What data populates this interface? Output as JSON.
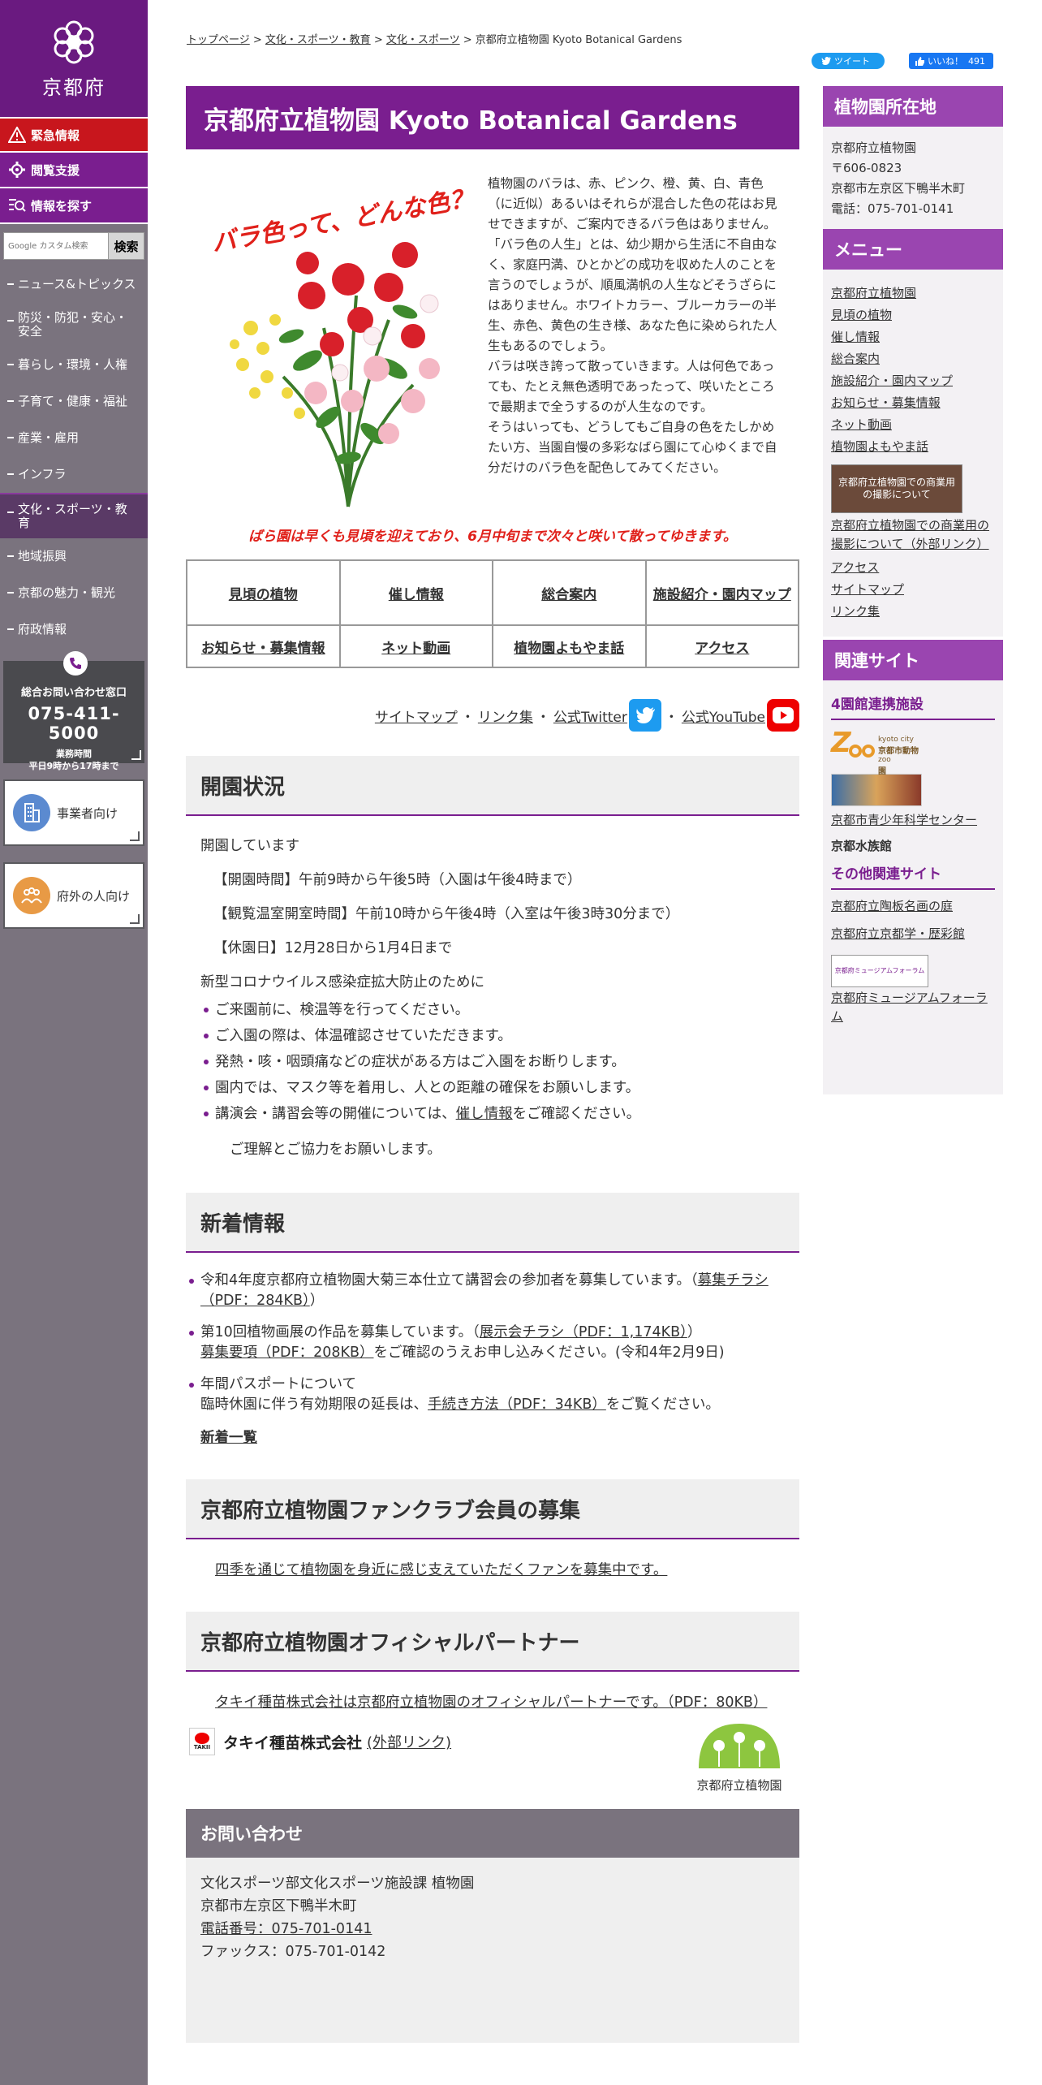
{
  "header": {
    "site_name": "京都府",
    "breadcrumb": [
      {
        "label": "トップページ"
      },
      {
        "label": "文化・スポーツ・教育"
      },
      {
        "label": "文化・スポーツ"
      }
    ],
    "breadcrumb_current": "京都府立植物園 Kyoto Botanical Gardens",
    "tweet_label": "ツイート",
    "like_label": "いいね！",
    "like_count": "491"
  },
  "sidebar": {
    "emergency_label": "緊急情報",
    "support_label": "閲覧支援",
    "find_label": "情報を探す",
    "search_placeholder": "Google カスタム検索",
    "search_button": "検索",
    "nav": [
      {
        "label": "ニュース&トピックス"
      },
      {
        "label": "防災・防犯・安心・安全"
      },
      {
        "label": "暮らし・環境・人権"
      },
      {
        "label": "子育て・健康・福祉"
      },
      {
        "label": "産業・雇用"
      },
      {
        "label": "インフラ"
      },
      {
        "label": "文化・スポーツ・教育"
      },
      {
        "label": "地域振興"
      },
      {
        "label": "京都の魅力・観光"
      },
      {
        "label": "府政情報"
      }
    ],
    "contact": {
      "title": "総合お問い合わせ窓口",
      "phone": "075-411-5000",
      "hours_label": "業務時間",
      "hours": "平日9時から17時まで"
    },
    "business_label": "事業者向け",
    "outside_label": "府外の人向け"
  },
  "main": {
    "title": "京都府立植物園 Kyoto Botanical Gardens",
    "rose_art_title": "バラ色って、どんな色？",
    "intro_paragraphs": [
      "植物園のバラは、赤、ピンク、橙、黄、白、青色（に近似）あるいはそれらが混合した色の花はお見せできますが、ご案内できるバラ色はありません。",
      "「バラ色の人生」とは、幼少期から生活に不自由なく、家庭円満、ひとかどの成功を収めた人のことを言うのでしょうが、順風満帆の人生などそうざらにはありません。ホワイトカラー、ブルーカラーの半生、赤色、黄色の生き様、あなた色に染められた人生もあるのでしょう。",
      "バラは咲き誇って散っていきます。人は何色であっても、たとえ無色透明であったって、咲いたところで最期まで全うするのが人生なのです。",
      "そうはいっても、どうしてもご自身の色をたしかめたい方、当園自慢の多彩なばら園にて心ゆくまで自分だけのバラ色を配色してみてください。"
    ],
    "rose_notice": "ばら園は早くも見頃を迎えており、6月中旬まで次々と咲いて散ってゆきます。",
    "nav_table": [
      [
        "見頃の植物",
        "催し情報",
        "総合案内",
        "施設紹介・園内マップ"
      ],
      [
        "お知らせ・募集情報",
        "ネット動画",
        "植物園よもやま話",
        "アクセス"
      ]
    ],
    "links_row": {
      "sitemap": "サイトマップ",
      "links": "リンク集",
      "twitter": "公式Twitter",
      "youtube": "公式YouTube",
      "sep": "・"
    },
    "status": {
      "heading": "開園状況",
      "open_text": "開園しています",
      "hours": "【開園時間】午前9時から午後5時（入園は午後4時まで）",
      "greenhouse": "【観覧温室開室時間】午前10時から午後4時（入室は午後3時30分まで）",
      "closed": "【休園日】12月28日から1月4日まで",
      "covid_title": "新型コロナウイルス感染症拡大防止のために",
      "covid_items": [
        "ご来園前に、検温等を行ってください。",
        "ご入園の際は、体温確認させていただきます。",
        "発熱・咳・咽頭痛などの症状がある方はご入園をお断りします。",
        "園内では、マスク等を着用し、人との距離の確保をお願いします。"
      ],
      "covid_last_pre": "講演会・講習会等の開催については、",
      "covid_last_link": "催し情報",
      "covid_last_post": "をご確認ください。",
      "thanks": "ご理解とご協力をお願いします。"
    },
    "news": {
      "heading": "新着情報",
      "item1_text": "令和4年度京都府立植物園大菊三本仕立て講習会の参加者を募集しています。（",
      "item1_link": "募集チラシ（PDF：284KB）",
      "item1_end": "）",
      "item2_text": "第10回植物画展の作品を募集しています。（",
      "item2_link1": "展示会チラシ（PDF：1,174KB）",
      "item2_mid": "）",
      "item2_link2": "募集要項（PDF：208KB）",
      "item2_end": "をご確認のうえお申し込みください。(令和4年2月9日)",
      "item3_line1": "年間パスポートについて",
      "item3_pre": "臨時休園に伴う有効期限の延長は、",
      "item3_link": "手続き方法（PDF：34KB）",
      "item3_post": "をご覧ください。",
      "list_link": "新着一覧"
    },
    "fanclub": {
      "heading": "京都府立植物園ファンクラブ会員の募集",
      "link": "四季を通じて植物園を身近に感じ支えていただくファンを募集中です。"
    },
    "partner": {
      "heading": "京都府立植物園オフィシャルパートナー",
      "link": "タキイ種苗株式会社は京都府立植物園のオフィシャルパートナーです。（PDF：80KB）",
      "company": "タキイ種苗株式会社",
      "ext_link": "(外部リンク)",
      "takii_logo_text": "TAKII",
      "garden_logo_text": "京都府立植物園"
    },
    "inquiry": {
      "heading": "お問い合わせ",
      "line1": "文化スポーツ部文化スポーツ施設課 植物園",
      "line2": "京都市左京区下鴨半木町",
      "phone_link": "電話番号：075-701-0141",
      "fax": "ファックス：075-701-0142"
    }
  },
  "right": {
    "location_heading": "植物園所在地",
    "location_lines": [
      "京都府立植物園",
      "〒606-0823",
      "京都市左京区下鴨半木町",
      "電話：075-701-0141"
    ],
    "menu_heading": "メニュー",
    "menu_items": [
      {
        "label": "京都府立植物園"
      },
      {
        "label": "見頃の植物"
      },
      {
        "label": "催し情報"
      },
      {
        "label": "総合案内"
      },
      {
        "label": "施設紹介・園内マップ"
      },
      {
        "label": "お知らせ・募集情報"
      },
      {
        "label": "ネット動画"
      },
      {
        "label": "植物園よもやま話"
      }
    ],
    "banner_text": "京都府立植物園での商業用の撮影について",
    "banner_link": "京都府立植物園での商業用の撮影について（外部リンク）",
    "menu_items2": [
      {
        "label": "アクセス"
      },
      {
        "label": "サイトマップ"
      },
      {
        "label": "リンク集"
      }
    ],
    "related_heading": "関連サイト",
    "four_museum_heading": "4園館連携施設",
    "zoo_logo_text": "kyoto city zoo",
    "zoo_logo_sub": "京都市動物園",
    "science_link": "京都市青少年科学センター",
    "aquarium": "京都水族館",
    "other_heading": "その他関連サイト",
    "ceramic_link": "京都府立陶板名画の庭",
    "history_link": "京都府立京都学・歴彩館",
    "forum_logo_text": "京都府ミュージアムフォーラム",
    "forum_link": "京都府ミュージアムフォーラム"
  },
  "colors": {
    "brand_purple": "#7a1e8f",
    "emergency_red": "#c8161d",
    "sidebar_gray": "#7a737e",
    "notice_red": "#e0201a"
  }
}
